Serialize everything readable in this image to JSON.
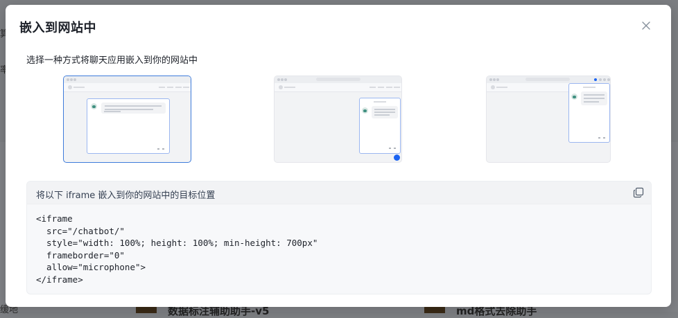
{
  "background": {
    "left_fragments": [
      "算",
      "率",
      "缓地"
    ],
    "card_titles": [
      "数据标注辅助助手-v5",
      "md格式去除助手"
    ]
  },
  "modal": {
    "title": "嵌入到网站中",
    "subtitle": "选择一种方式将聊天应用嵌入到你的网站中",
    "options": [
      {
        "name": "iframe",
        "selected": true
      },
      {
        "name": "script-bubble",
        "selected": false
      },
      {
        "name": "chrome-extension",
        "selected": false
      }
    ],
    "code_header": "将以下 iframe 嵌入到你的网站中的目标位置",
    "code": "<iframe\n  src=\"/chatbot/\"\n  style=\"width: 100%; height: 100%; min-height: 700px\"\n  frameborder=\"0\"\n  allow=\"microphone\">\n</iframe>",
    "accent_color": "#3d7bdb",
    "icons": {
      "close": "close-icon",
      "copy": "copy-icon"
    }
  }
}
